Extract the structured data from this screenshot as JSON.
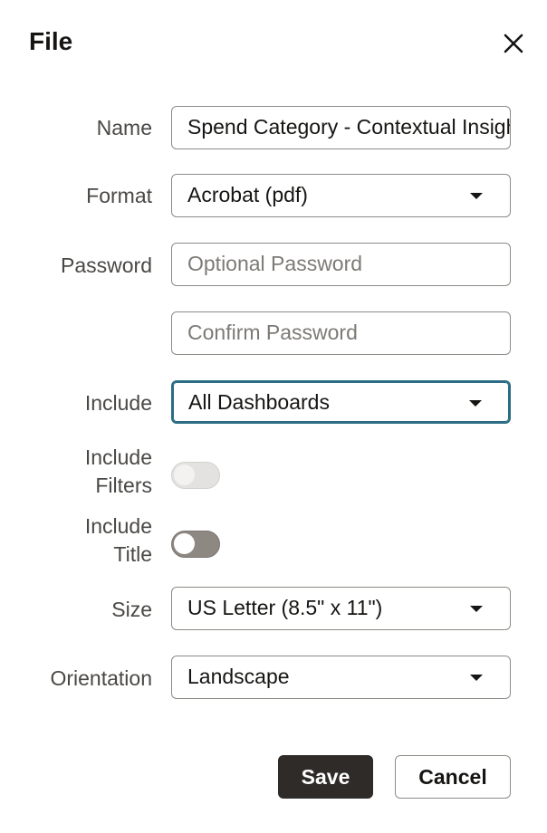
{
  "dialog": {
    "title": "File",
    "close_icon": "close-icon"
  },
  "form": {
    "name": {
      "label": "Name",
      "value": "Spend Category - Contextual Insights"
    },
    "format": {
      "label": "Format",
      "value": "Acrobat (pdf)"
    },
    "password": {
      "label": "Password",
      "placeholder": "Optional Password"
    },
    "confirm_password": {
      "placeholder": "Confirm Password"
    },
    "include": {
      "label": "Include",
      "value": "All Dashboards"
    },
    "include_filters": {
      "label_line1": "Include",
      "label_line2": "Filters",
      "state": "off",
      "enabled": false
    },
    "include_title": {
      "label_line1": "Include",
      "label_line2": "Title",
      "state": "off",
      "enabled": true
    },
    "size": {
      "label": "Size",
      "value": "US Letter (8.5\" x 11\")"
    },
    "orientation": {
      "label": "Orientation",
      "value": "Landscape"
    }
  },
  "actions": {
    "save_label": "Save",
    "cancel_label": "Cancel"
  },
  "colors": {
    "focus_border": "#2b6c84",
    "primary_button": "#2e2b28",
    "toggle_off": "#8e8883",
    "toggle_disabled": "#e4e2e0"
  }
}
